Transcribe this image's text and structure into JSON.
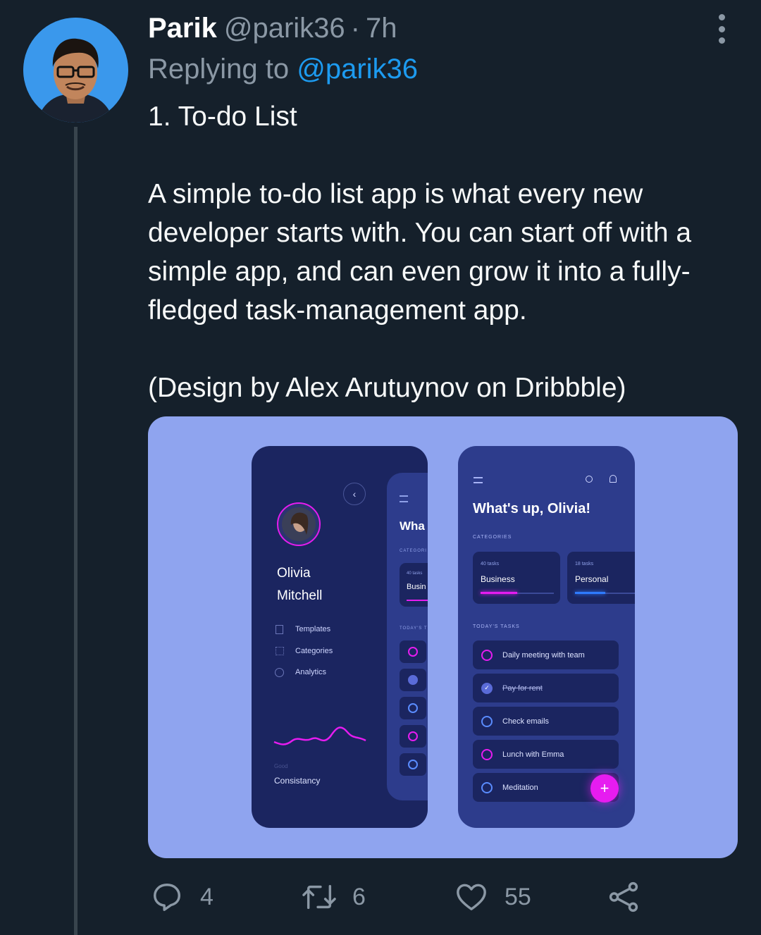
{
  "tweet": {
    "author_name": "Parik",
    "handle": "@parik36",
    "separator": "·",
    "time": "7h",
    "replying_to_label": "Replying to",
    "replying_to_handle": "@parik36",
    "paragraphs": [
      "1. To-do List",
      "A simple to-do list app is what every new developer starts with. You can start off with a simple app, and can even grow it into a fully-fledged task-management app.",
      "(Design by Alex Arutuynov on Dribbble)"
    ]
  },
  "media": {
    "left_phone": {
      "first_name": "Olivia",
      "last_name": "Mitchell",
      "menu": [
        "Templates",
        "Categories",
        "Analytics"
      ],
      "stat_caption": "Good",
      "stat_label": "Consistancy",
      "peek_title": "Wha",
      "peek_categories": "CATEGORI",
      "peek_card_count": "40 tasks",
      "peek_card_name": "Busin",
      "peek_today": "TODAY'S T"
    },
    "right_phone": {
      "greeting": "What's up, Olivia!",
      "categories_heading": "CATEGORIES",
      "categories": [
        {
          "count": "40 tasks",
          "name": "Business",
          "progress": 0.5,
          "color": "#e61cf0"
        },
        {
          "count": "18 tasks",
          "name": "Personal",
          "progress": 0.45,
          "color": "#2f7bff"
        }
      ],
      "today_heading": "TODAY'S TASKS",
      "tasks": [
        {
          "label": "Daily meeting with team",
          "done": false,
          "color": "#e61cf0"
        },
        {
          "label": "Pay for rent",
          "done": true,
          "color": "#5a6bd8"
        },
        {
          "label": "Check emails",
          "done": false,
          "color": "#5a8cff"
        },
        {
          "label": "Lunch with Emma",
          "done": false,
          "color": "#e61cf0"
        },
        {
          "label": "Meditation",
          "done": false,
          "color": "#5a8cff"
        }
      ],
      "fab_symbol": "+"
    }
  },
  "actions": {
    "replies": "4",
    "retweets": "6",
    "likes": "55"
  },
  "colors": {
    "background": "#15202b",
    "muted": "#8b98a5",
    "link": "#1d9bf0",
    "accent_magenta": "#e61cf0"
  }
}
